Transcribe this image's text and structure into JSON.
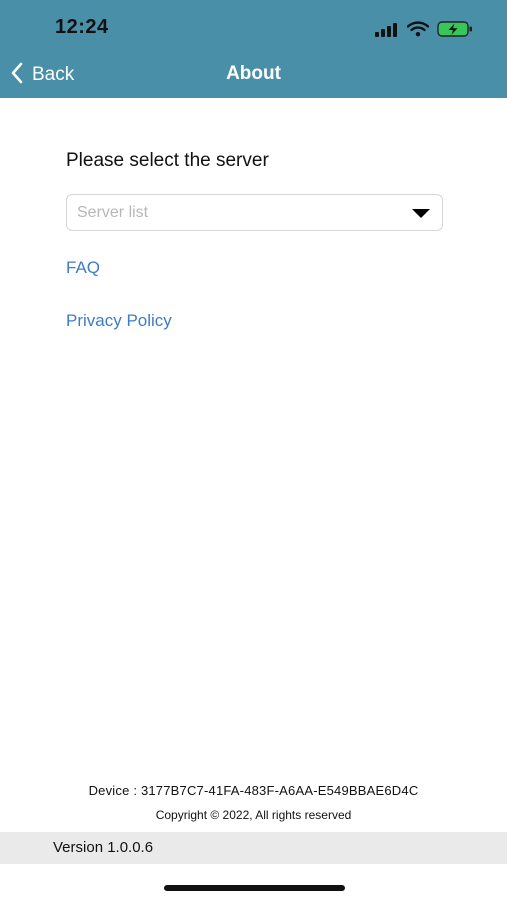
{
  "status_bar": {
    "time": "12:24",
    "icons": [
      "cellular-signal-icon",
      "wifi-icon",
      "battery-charging-icon"
    ]
  },
  "nav": {
    "back_label": "Back",
    "title": "About",
    "back_icon": "chevron-left-icon"
  },
  "server": {
    "prompt": "Please select the server",
    "placeholder": "Server list",
    "arrow_icon": "dropdown-arrow-icon"
  },
  "links": {
    "faq": "FAQ",
    "privacy": "Privacy Policy"
  },
  "footer": {
    "device": "Device : 3177B7C7-41FA-483F-A6AA-E549BBAE6D4C",
    "copyright": "Copyright © 2022, All rights reserved",
    "version": "Version 1.0.0.6"
  },
  "colors": {
    "header": "#4a8fa8",
    "link": "#3d7dc4",
    "battery": "#35c759"
  }
}
